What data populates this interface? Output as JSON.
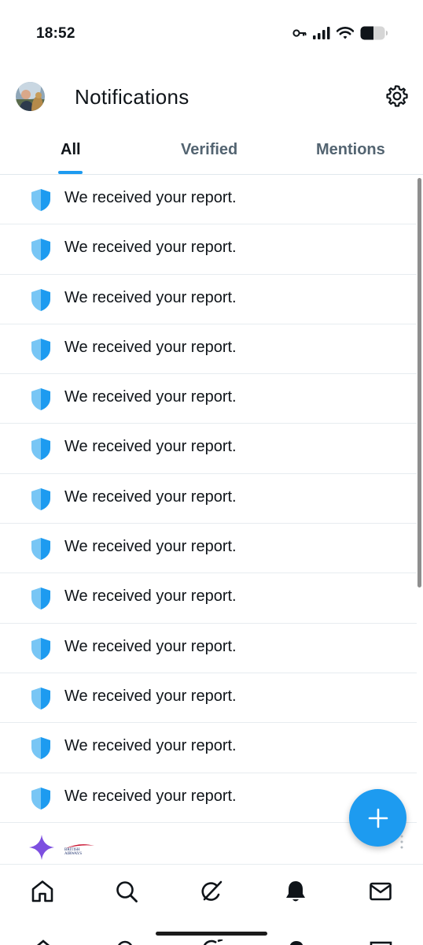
{
  "status_bar": {
    "time": "18:52"
  },
  "header": {
    "title": "Notifications"
  },
  "tabs": [
    {
      "label": "All",
      "active": true
    },
    {
      "label": "Verified",
      "active": false
    },
    {
      "label": "Mentions",
      "active": false
    }
  ],
  "notifications": [
    {
      "icon": "shield-icon",
      "text": "We received your report."
    },
    {
      "icon": "shield-icon",
      "text": "We received your report."
    },
    {
      "icon": "shield-icon",
      "text": "We received your report."
    },
    {
      "icon": "shield-icon",
      "text": "We received your report."
    },
    {
      "icon": "shield-icon",
      "text": "We received your report."
    },
    {
      "icon": "shield-icon",
      "text": "We received your report."
    },
    {
      "icon": "shield-icon",
      "text": "We received your report."
    },
    {
      "icon": "shield-icon",
      "text": "We received your report."
    },
    {
      "icon": "shield-icon",
      "text": "We received your report."
    },
    {
      "icon": "shield-icon",
      "text": "We received your report."
    },
    {
      "icon": "shield-icon",
      "text": "We received your report."
    },
    {
      "icon": "shield-icon",
      "text": "We received your report."
    },
    {
      "icon": "shield-icon",
      "text": "We received your report."
    }
  ],
  "partial_notification": {
    "icon": "sparkle-icon",
    "brand_logo_text": "BRITISH AIRWAYS"
  },
  "bottom_nav": [
    {
      "name": "home",
      "icon": "home-icon"
    },
    {
      "name": "search",
      "icon": "search-icon"
    },
    {
      "name": "grok",
      "icon": "grok-icon"
    },
    {
      "name": "notifications",
      "icon": "bell-icon",
      "active": true
    },
    {
      "name": "messages",
      "icon": "mail-icon"
    }
  ],
  "colors": {
    "accent": "#1d9bf0",
    "shield_light": "#78c6f5",
    "shield_dark": "#1d9bf0",
    "sparkle": "#7d4fe0",
    "text_primary": "#0f1419",
    "text_secondary": "#536471"
  }
}
